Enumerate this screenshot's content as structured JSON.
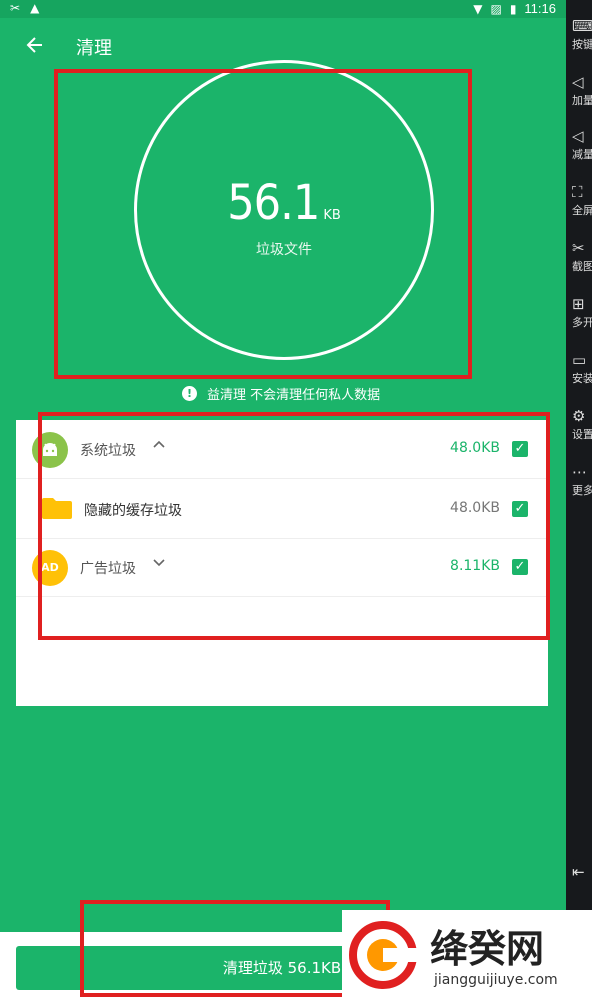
{
  "status_bar": {
    "time": "11:16",
    "icons": [
      "tools-icon",
      "notification-icon",
      "wifi-icon",
      "signal-x-icon",
      "battery-icon"
    ]
  },
  "toolbar": {
    "title": "清理"
  },
  "summary": {
    "value": "56.1",
    "unit": "KB",
    "label": "垃圾文件"
  },
  "notice": "益清理 不会清理任何私人数据",
  "items": [
    {
      "label": "系统垃圾",
      "size": "48.0KB",
      "size_color": "#1bb46a",
      "expand": "chevron-up",
      "checked": true
    },
    {
      "label": "隐藏的缓存垃圾",
      "size": "48.0KB",
      "size_color": "#777777",
      "checked": true
    },
    {
      "label": "广告垃圾",
      "size": "8.11KB",
      "size_color": "#1bb46a",
      "expand": "chevron-down",
      "checked": true,
      "icon_text": "AD"
    }
  ],
  "bottom": {
    "button_label": "清理垃圾 56.1KB"
  },
  "sidebar": [
    "按键",
    "加量",
    "减量",
    "全屏",
    "截图",
    "多开",
    "安装",
    "设置",
    "更多"
  ],
  "watermark": {
    "text": "绛癸网",
    "url": "jiangguijiuye.com"
  },
  "colors": {
    "primary": "#1bb46a",
    "sidebar_bg": "#17191c",
    "highlight": "#e02020"
  }
}
